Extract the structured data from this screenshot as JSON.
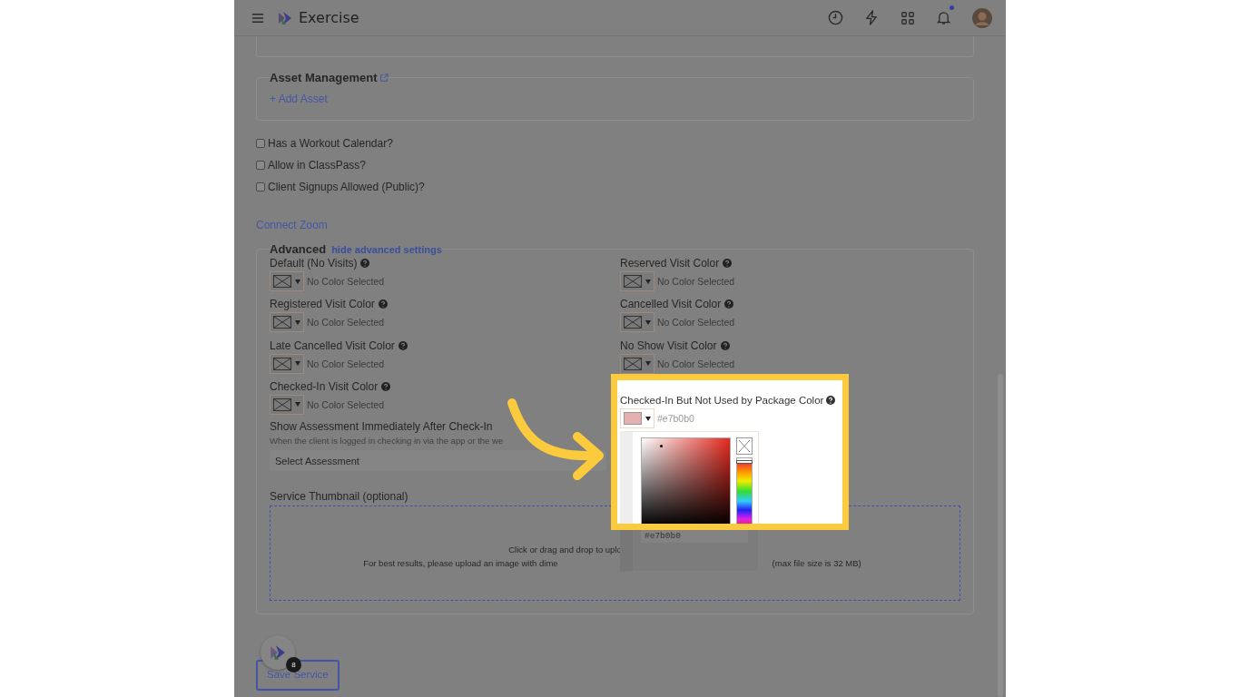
{
  "header": {
    "app_name": "Exercise",
    "notifications_unread": true
  },
  "asset_management": {
    "title": "Asset Management",
    "add_link": "+ Add Asset"
  },
  "checkboxes": [
    {
      "label": "Has a Workout Calendar?",
      "checked": false
    },
    {
      "label": "Allow in ClassPass?",
      "checked": false
    },
    {
      "label": "Client Signups Allowed (Public)?",
      "checked": false
    }
  ],
  "connect_link": "Connect Zoom",
  "advanced": {
    "title": "Advanced",
    "toggle_link": "hide advanced settings",
    "color_fields_left": [
      {
        "label": "Default (No Visits)",
        "value": "No Color Selected"
      },
      {
        "label": "Registered Visit Color",
        "value": "No Color Selected"
      },
      {
        "label": "Late Cancelled Visit Color",
        "value": "No Color Selected"
      },
      {
        "label": "Checked-In Visit Color",
        "value": "No Color Selected"
      }
    ],
    "color_fields_right": [
      {
        "label": "Reserved Visit Color",
        "value": "No Color Selected"
      },
      {
        "label": "Cancelled Visit Color",
        "value": "No Color Selected"
      },
      {
        "label": "No Show Visit Color",
        "value": "No Color Selected"
      }
    ],
    "highlighted_field": {
      "label": "Checked-In But Not Used by Package Color",
      "value": "#e7b0b0",
      "color": "#e7b0b0",
      "picker_input": "#e7b0b0",
      "hue_slider": {
        "level": 0.03
      }
    },
    "assessment": {
      "label": "Show Assessment Immediately After Check-In",
      "hint": "When the client is logged in checking in via the app or the we",
      "placeholder": "Select Assessment"
    },
    "thumbnail": {
      "label": "Service Thumbnail (optional)",
      "line_1": "Click or drag and drop to uplo",
      "line_2a": "For best results, please upload an image with dime",
      "line_2b": "(max file size is 32 MB)"
    }
  },
  "launcher_badge": "8",
  "save_button": "Save Service"
}
